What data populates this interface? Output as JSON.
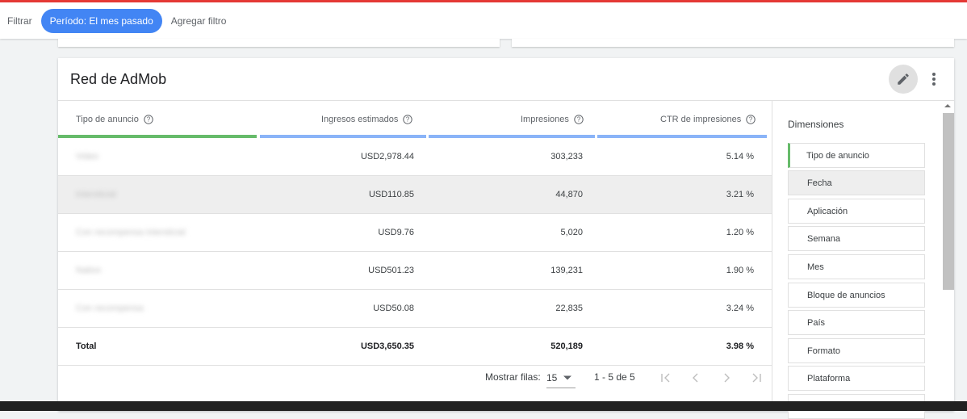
{
  "filterbar": {
    "label": "Filtrar",
    "chip": "Período: El mes pasado",
    "add": "Agregar filtro"
  },
  "card": {
    "title": "Red de AdMob",
    "edit_icon": "pencil-icon",
    "more_icon": "more-vert-icon"
  },
  "table": {
    "headers": [
      "Tipo de anuncio",
      "Ingresos estimados",
      "Impresiones",
      "CTR de impresiones"
    ],
    "header_bar_colors": [
      "#66bb6a",
      "#8ab4f8",
      "#8ab4f8",
      "#8ab4f8"
    ],
    "rows": [
      [
        "Video",
        "USD2,978.44",
        "303,233",
        "5.14 %"
      ],
      [
        "Intersticial",
        "USD110.85",
        "44,870",
        "3.21 %"
      ],
      [
        "Con recompensa intersticial",
        "USD9.76",
        "5,020",
        "1.20 %"
      ],
      [
        "Nativo",
        "USD501.23",
        "139,231",
        "1.90 %"
      ],
      [
        "Con recompensa",
        "USD50.08",
        "22,835",
        "3.24 %"
      ]
    ],
    "total": [
      "Total",
      "USD3,650.35",
      "520,189",
      "3.98 %"
    ]
  },
  "pager": {
    "rows_label": "Mostrar filas:",
    "rows_value": "15",
    "range": "1 - 5 de 5"
  },
  "dimensions": {
    "title": "Dimensiones",
    "items": [
      "Tipo de anuncio",
      "Fecha",
      "Aplicación",
      "Semana",
      "Mes",
      "Bloque de anuncios",
      "País",
      "Formato",
      "Plataforma"
    ]
  }
}
